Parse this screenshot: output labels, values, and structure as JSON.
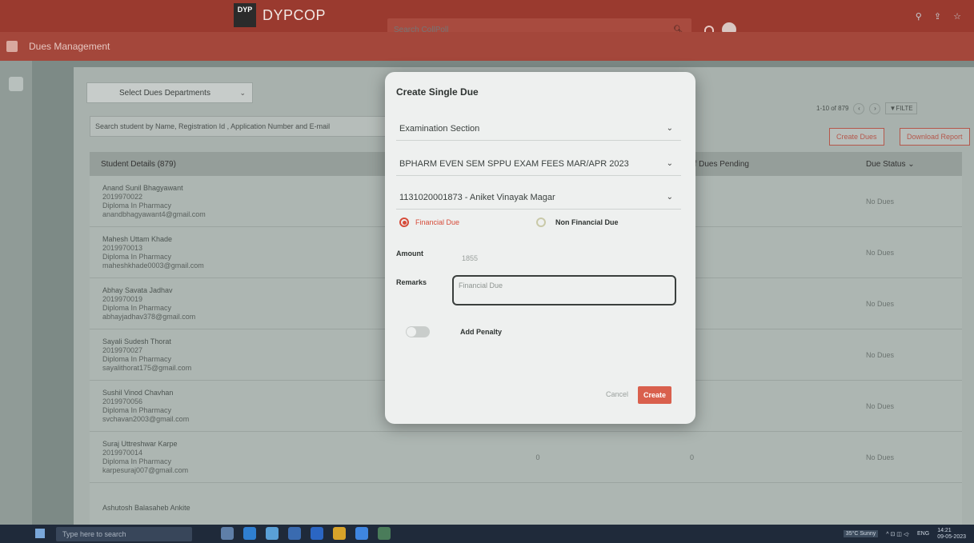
{
  "app": {
    "brand_logo_text": "DYP",
    "brand_name": "DYPCOP",
    "search_placeholder": "Search CollPoll",
    "module_title": "Dues Management"
  },
  "toolbar": {
    "department_select": "Select Dues Departments",
    "student_search_placeholder": "Search student by Name, Registration Id , Application Number and E-mail",
    "pagination_text": "1-10 of 879",
    "filter_label": "FILTE",
    "create_dues_label": "Create Dues",
    "download_report_label": "Download Report"
  },
  "table": {
    "headers": [
      "Student Details (879)",
      "",
      "of Dues Pending",
      "Due Status"
    ],
    "rows": [
      {
        "name": "Anand Sunil Bhagyawant",
        "id": "2019970022",
        "program": "Diploma In Pharmacy",
        "email": "anandbhagyawant4@gmail.com",
        "mid": "",
        "pending": "0",
        "status": "No Dues"
      },
      {
        "name": "Mahesh Uttam Khade",
        "id": "2019970013",
        "program": "Diploma In Pharmacy",
        "email": "maheshkhade0003@gmail.com",
        "mid": "",
        "pending": "0",
        "status": "No Dues"
      },
      {
        "name": "Abhay Savata Jadhav",
        "id": "2019970019",
        "program": "Diploma In Pharmacy",
        "email": "abhayjadhav378@gmail.com",
        "mid": "",
        "pending": "0",
        "status": "No Dues"
      },
      {
        "name": "Sayali Sudesh Thorat",
        "id": "2019970027",
        "program": "Diploma In Pharmacy",
        "email": "sayalithorat175@gmail.com",
        "mid": "",
        "pending": "0",
        "status": "No Dues"
      },
      {
        "name": "Sushil Vinod Chavhan",
        "id": "2019970056",
        "program": "Diploma In Pharmacy",
        "email": "svchavan2003@gmail.com",
        "mid": "0",
        "pending": "0",
        "status": "No Dues"
      },
      {
        "name": "Suraj Uttreshwar Karpe",
        "id": "2019970014",
        "program": "Diploma In Pharmacy",
        "email": "karpesuraj007@gmail.com",
        "mid": "0",
        "pending": "0",
        "status": "No Dues"
      },
      {
        "name": "Ashutosh Balasaheb Ankite",
        "id": "",
        "program": "",
        "email": "",
        "mid": "",
        "pending": "",
        "status": ""
      }
    ]
  },
  "modal": {
    "title": "Create Single Due",
    "department": "Examination Section",
    "fee_type": "BPHARM EVEN SEM SPPU EXAM FEES MAR/APR 2023",
    "student": "1131020001873 - Aniket Vinayak Magar",
    "radio_financial": "Financial Due",
    "radio_non_financial": "Non Financial Due",
    "amount_label": "Amount",
    "amount_value": "1855",
    "remarks_label": "Remarks",
    "remarks_value": "Financial Due",
    "penalty_label": "Add Penalty",
    "cancel_label": "Cancel",
    "create_label": "Create"
  },
  "taskbar": {
    "search_placeholder": "Type here to search",
    "weather": "35°C Sunny",
    "language": "ENG",
    "time": "14:21",
    "date": "09-05-2023"
  },
  "colors": {
    "brand": "#9a3a2f",
    "accent": "#d9604d"
  }
}
